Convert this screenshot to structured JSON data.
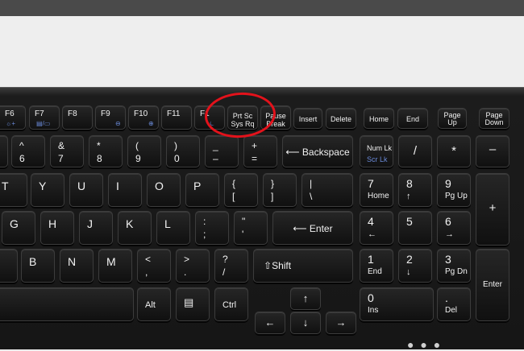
{
  "function_row": {
    "f6": "F6",
    "f7": "F7",
    "f8": "F8",
    "f9": "F9",
    "f10": "F10",
    "f11": "F11",
    "f12": "F1",
    "prtsc_top": "Prt Sc",
    "prtsc_bottom": "Sys Rq",
    "pause_top": "Pause",
    "pause_bottom": "Break",
    "insert": "Insert",
    "delete": "Delete",
    "home": "Home",
    "end": "End",
    "pgup_top": "Page",
    "pgup_bottom": "Up",
    "pgdn_top": "Page",
    "pgdn_bottom": "Down"
  },
  "number_row": {
    "k6_top": "^",
    "k6_bottom": "6",
    "k7_top": "&",
    "k7_bottom": "7",
    "k8_top": "*",
    "k8_bottom": "8",
    "k9_top": "(",
    "k9_bottom": "9",
    "k0_top": ")",
    "k0_bottom": "0",
    "minus_top": "_",
    "minus_bottom": "–",
    "equal_top": "+",
    "equal_bottom": "=",
    "backspace": "Backspace",
    "numlk_top": "Num Lk",
    "numlk_bottom": "Scr Lk",
    "np_slash": "/",
    "np_star": "*",
    "np_minus": "–"
  },
  "top_row": {
    "t": "T",
    "y": "Y",
    "u": "U",
    "i": "I",
    "o": "O",
    "p": "P",
    "lbrace_top": "{",
    "lbrace_bottom": "[",
    "rbrace_top": "}",
    "rbrace_bottom": "]",
    "pipe_top": "|",
    "pipe_bottom": "\\",
    "np7_top": "7",
    "np7_bottom": "Home",
    "np8_top": "8",
    "np8_bottom": "↑",
    "np9_top": "9",
    "np9_bottom": "Pg Up",
    "np_plus": "+"
  },
  "home_row": {
    "g": "G",
    "h": "H",
    "j": "J",
    "k": "K",
    "l": "L",
    "colon_top": ":",
    "colon_bottom": ";",
    "quote_top": "\"",
    "quote_bottom": "'",
    "enter": "Enter",
    "np4_top": "4",
    "np4_bottom": "←",
    "np5": "5",
    "np6_top": "6",
    "np6_bottom": "→"
  },
  "bottom_row": {
    "b": "B",
    "n": "N",
    "m": "M",
    "lt_top": "<",
    "lt_bottom": ",",
    "gt_top": ">",
    "gt_bottom": ".",
    "q_top": "?",
    "q_bottom": "/",
    "shift": "Shift",
    "np1_top": "1",
    "np1_bottom": "End",
    "np2_top": "2",
    "np2_bottom": "↓",
    "np3_top": "3",
    "np3_bottom": "Pg Dn",
    "np_enter": "Enter"
  },
  "space_row": {
    "alt": "Alt",
    "ctrl": "Ctrl",
    "up": "↑",
    "left": "←",
    "down": "↓",
    "right": "→",
    "np0_top": "0",
    "np0_bottom": "Ins",
    "npdot_top": ".",
    "npdot_bottom": "Del"
  },
  "colors": {
    "highlight": "#e3121b",
    "fn_secondary": "#6a8ad8"
  }
}
